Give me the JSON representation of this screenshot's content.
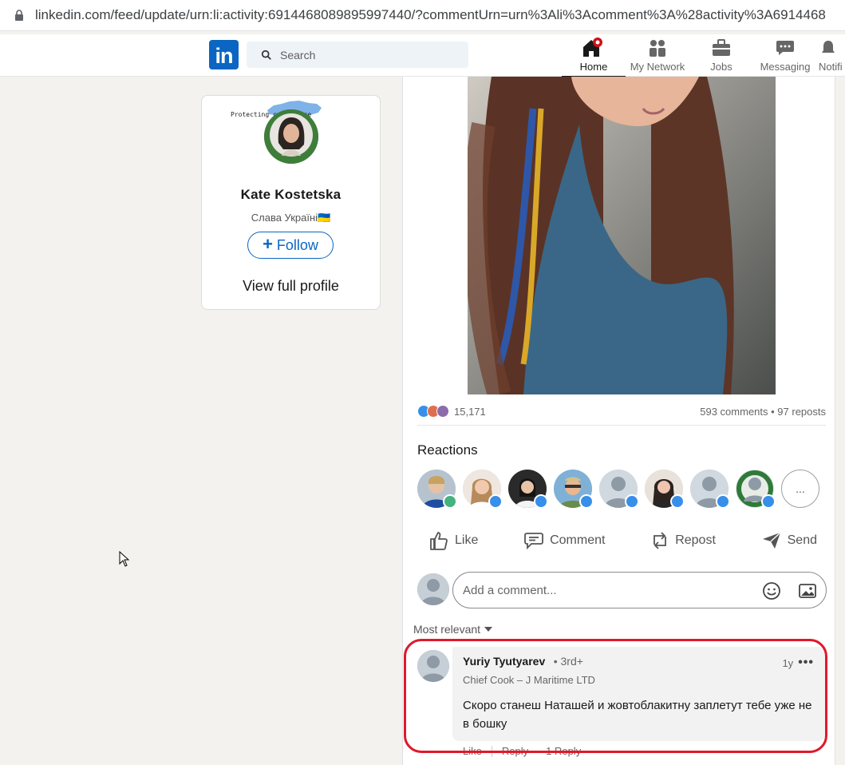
{
  "browser": {
    "url": "linkedin.com/feed/update/urn:li:activity:6914468089895997440/?commentUrn=urn%3Ali%3Acomment%3A%28activity%3A6914468"
  },
  "nav": {
    "logo": "in",
    "search_placeholder": "Search",
    "items": [
      {
        "label": "Home",
        "icon": "home-icon"
      },
      {
        "label": "My Network",
        "icon": "people-icon"
      },
      {
        "label": "Jobs",
        "icon": "briefcase-icon"
      },
      {
        "label": "Messaging",
        "icon": "chat-icon"
      },
      {
        "label": "Notifi",
        "icon": "bell-icon"
      }
    ]
  },
  "profile": {
    "banner_text": "Protecting        cyberspace",
    "name": "Kate Kostetska",
    "headline": "Слава Україні🇺🇦",
    "follow_label": "Follow",
    "view_profile_label": "View full profile"
  },
  "post": {
    "reactions_count": "15,171",
    "stats": "593 comments • 97 reposts",
    "reactions_title": "Reactions",
    "more_reactors": "...",
    "actions": {
      "like": "Like",
      "comment": "Comment",
      "repost": "Repost",
      "send": "Send"
    },
    "comment_placeholder": "Add a comment...",
    "sort_label": "Most relevant"
  },
  "comment": {
    "author": "Yuriy Tyutyarev",
    "degree": "• 3rd+",
    "time": "1y",
    "menu": "•••",
    "subtitle": "Chief Cook – J Maritime LTD",
    "text": "Скоро станеш Наташей и жовтоблакитну заплетут тебе уже не в бошку",
    "like": "Like",
    "reply": "Reply",
    "replies": "1 Reply"
  },
  "colors": {
    "brand": "#0a66c2",
    "highlight": "#e0182a",
    "background": "#f3f2ef"
  }
}
